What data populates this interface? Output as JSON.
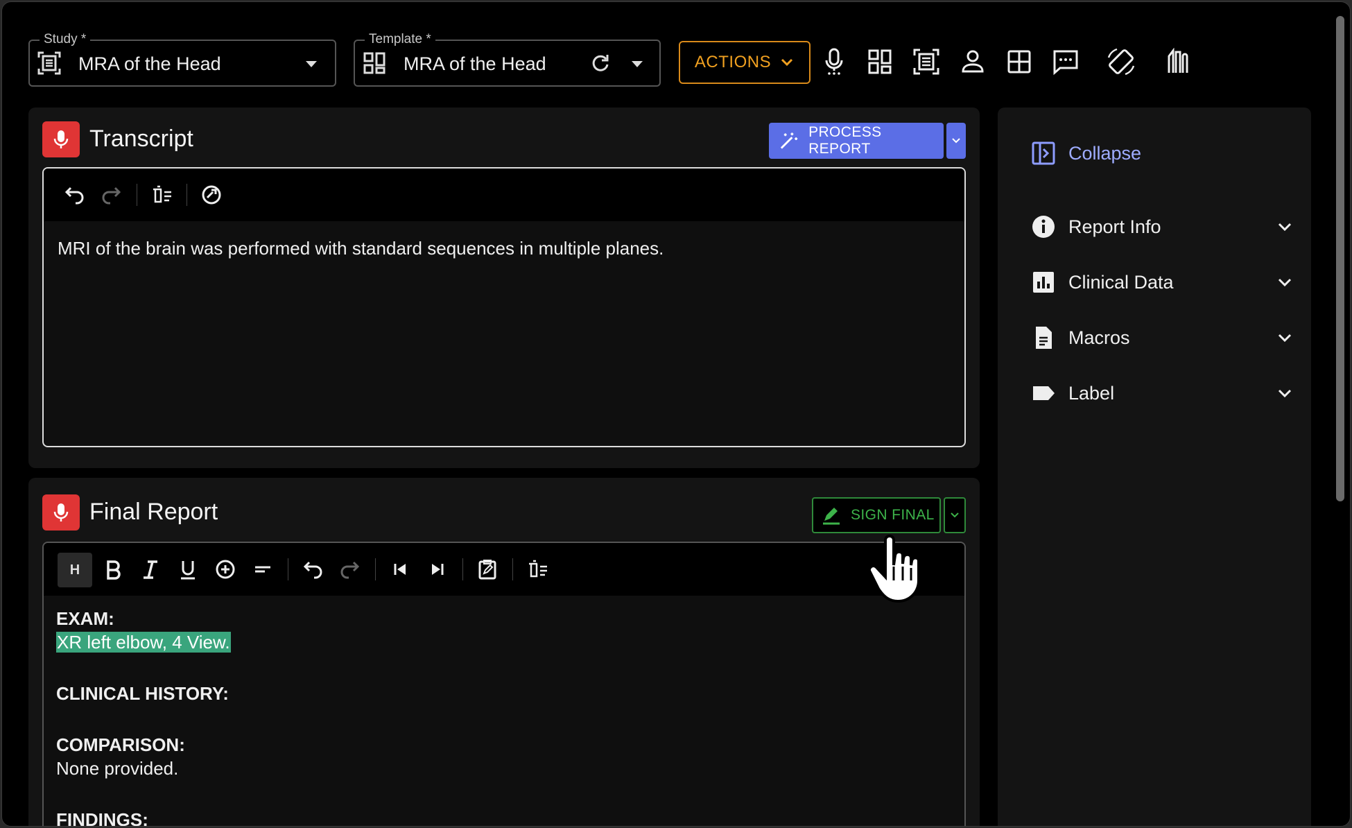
{
  "study": {
    "legend": "Study *",
    "value": "MRA of the Head"
  },
  "template": {
    "legend": "Template *",
    "value": "MRA of the Head"
  },
  "toolbar": {
    "actions_label": "ACTIONS",
    "icons": [
      "microphone-icon",
      "dashboard-icon",
      "document-scan-icon",
      "person-icon",
      "grid-icon",
      "comment-icon",
      "rotate-screen-icon",
      "brush-tool-icon"
    ]
  },
  "transcript": {
    "title": "Transcript",
    "process_label": "PROCESS REPORT",
    "text": "MRI of the brain was performed with standard sequences in multiple planes."
  },
  "final_report": {
    "title": "Final Report",
    "sign_label": "SIGN FINAL",
    "heading_btn": "H",
    "lines": [
      {
        "text": "EXAM:",
        "style": "bold"
      },
      {
        "text": "XR left elbow, 4 View.",
        "style": "highlight"
      },
      {
        "text": "",
        "style": "blank"
      },
      {
        "text": "CLINICAL HISTORY:",
        "style": "bold"
      },
      {
        "text": "",
        "style": "blank"
      },
      {
        "text": "COMPARISON:",
        "style": "bold"
      },
      {
        "text": "None provided.",
        "style": "normal"
      },
      {
        "text": "",
        "style": "blank"
      },
      {
        "text": "FINDINGS:",
        "style": "bold"
      }
    ]
  },
  "sidebar": {
    "collapse_label": "Collapse",
    "items": [
      {
        "label": "Report Info",
        "icon": "info-icon"
      },
      {
        "label": "Clinical Data",
        "icon": "bar-chart-icon"
      },
      {
        "label": "Macros",
        "icon": "document-icon"
      },
      {
        "label": "Label",
        "icon": "label-tag-icon"
      }
    ]
  },
  "colors": {
    "accent_blue": "#5b6ee6",
    "sign_green": "#3db34a",
    "actions_orange": "#f0a020",
    "mic_red": "#e03535",
    "highlight": "#3aa57d"
  }
}
